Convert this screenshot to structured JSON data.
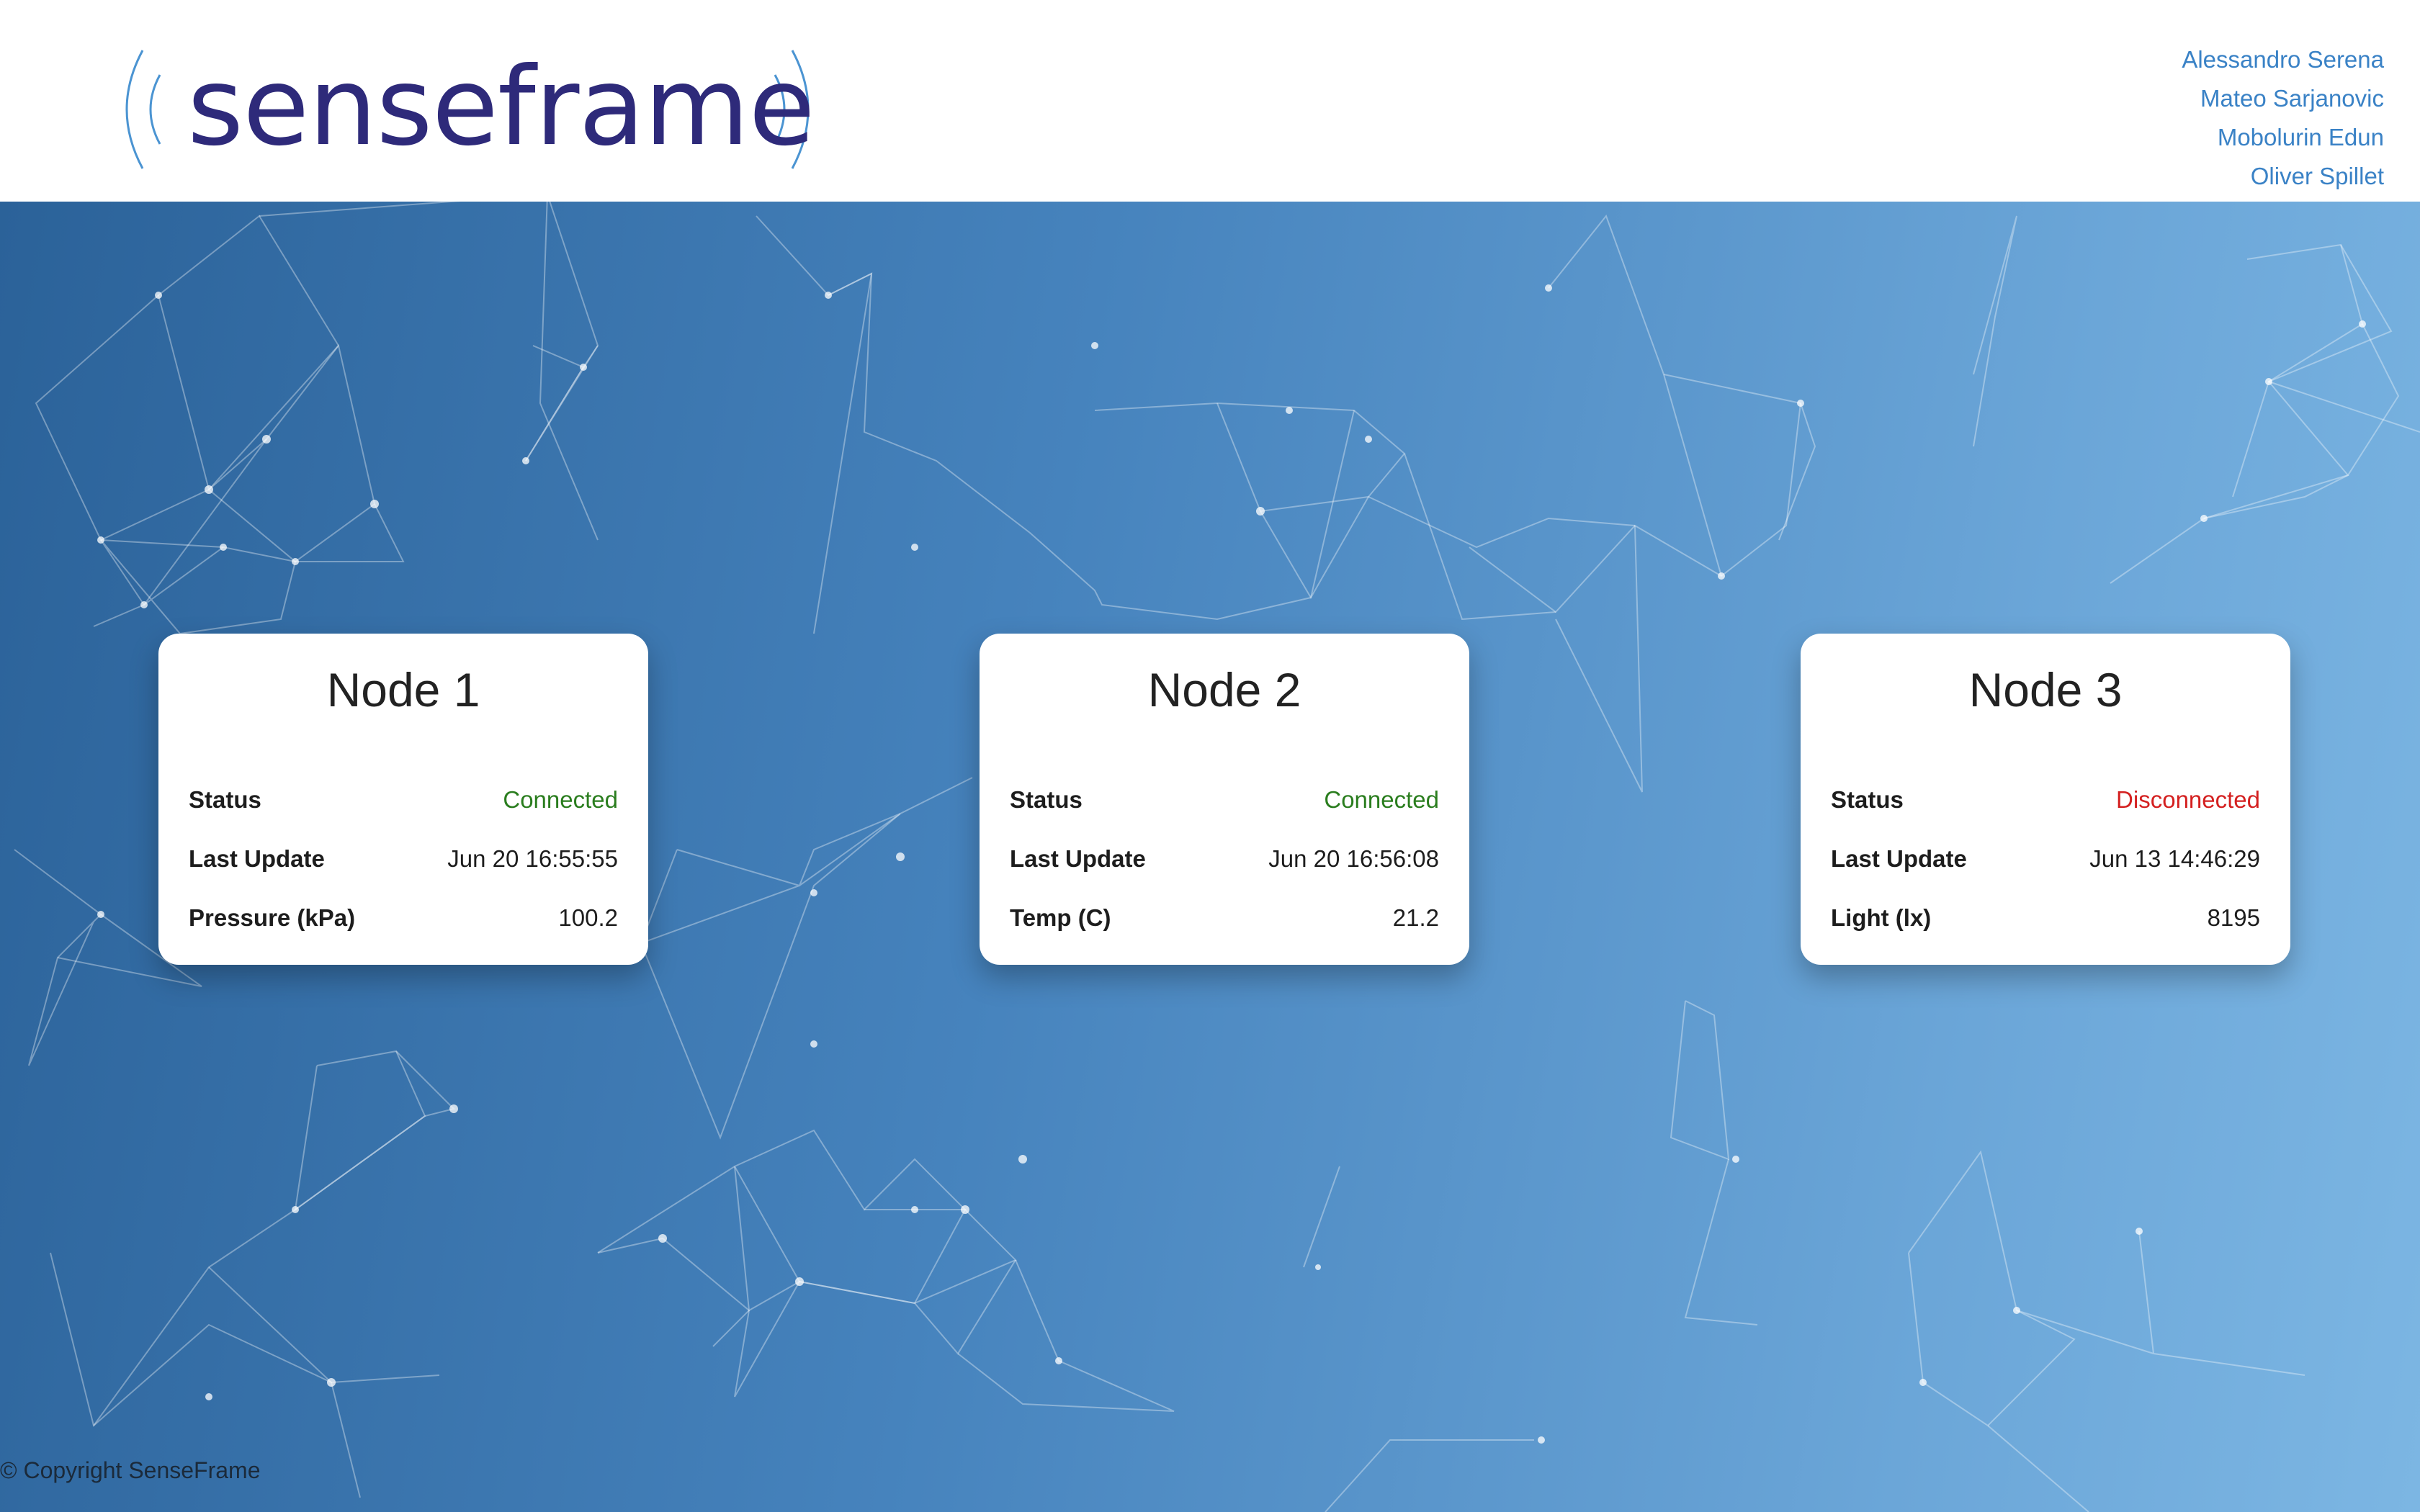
{
  "app": {
    "logo_text": "senseframe"
  },
  "header": {
    "team": [
      {
        "label": "Alessandro Serena"
      },
      {
        "label": "Mateo Sarjanovic"
      },
      {
        "label": "Mobolurin Edun"
      },
      {
        "label": "Oliver Spillet"
      }
    ]
  },
  "nodes": [
    {
      "title": "Node 1",
      "rows": [
        {
          "label": "Status",
          "value": "Connected",
          "state": "connected"
        },
        {
          "label": "Last Update",
          "value": "Jun 20 16:55:55"
        },
        {
          "label": "Pressure (kPa)",
          "value": "100.2"
        }
      ]
    },
    {
      "title": "Node 2",
      "rows": [
        {
          "label": "Status",
          "value": "Connected",
          "state": "connected"
        },
        {
          "label": "Last Update",
          "value": "Jun 20 16:56:08"
        },
        {
          "label": "Temp (C)",
          "value": "21.2"
        }
      ]
    },
    {
      "title": "Node 3",
      "rows": [
        {
          "label": "Status",
          "value": "Disconnected",
          "state": "disconnected"
        },
        {
          "label": "Last Update",
          "value": "Jun 13 14:46:29"
        },
        {
          "label": "Light (lx)",
          "value": "8195"
        }
      ]
    }
  ],
  "footer": {
    "copyright": "© Copyright SenseFrame"
  },
  "colors": {
    "brand": "#2e2a7a",
    "link": "#3a82c6",
    "connected": "#2a7d1e",
    "disconnected": "#d42020",
    "background_start": "#2b6299",
    "background_end": "#7cb6e3"
  },
  "icons": [
    "signal-waves-icon"
  ]
}
